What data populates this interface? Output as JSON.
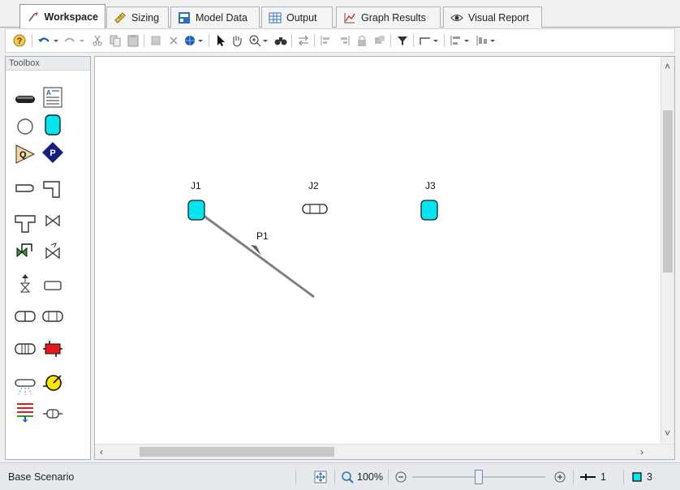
{
  "tabs": [
    {
      "label": "Workspace",
      "icon": "workspace-icon",
      "active": true
    },
    {
      "label": "Sizing",
      "icon": "ruler-icon",
      "active": false
    },
    {
      "label": "Model Data",
      "icon": "model-data-icon",
      "active": false
    },
    {
      "label": "Output",
      "icon": "table-icon",
      "active": false
    },
    {
      "label": "Graph Results",
      "icon": "graph-icon",
      "active": false
    },
    {
      "label": "Visual Report",
      "icon": "eye-icon",
      "active": false
    }
  ],
  "toolbox": {
    "title": "Toolbox"
  },
  "canvas": {
    "junctions": [
      {
        "label": "J1",
        "type": "reservoir"
      },
      {
        "label": "J2",
        "type": "branch"
      },
      {
        "label": "J3",
        "type": "reservoir"
      }
    ],
    "pipes": [
      {
        "label": "P1",
        "from": "J1"
      }
    ]
  },
  "status": {
    "scenario": "Base Scenario",
    "zoom": "100%",
    "pipe_count": "1",
    "junction_count": "3",
    "zoom_slider_fraction": 0.5
  },
  "colors": {
    "reservoir_fill": "#00e5ee",
    "pipe": "#808080",
    "accent": "#1a5fb4"
  }
}
